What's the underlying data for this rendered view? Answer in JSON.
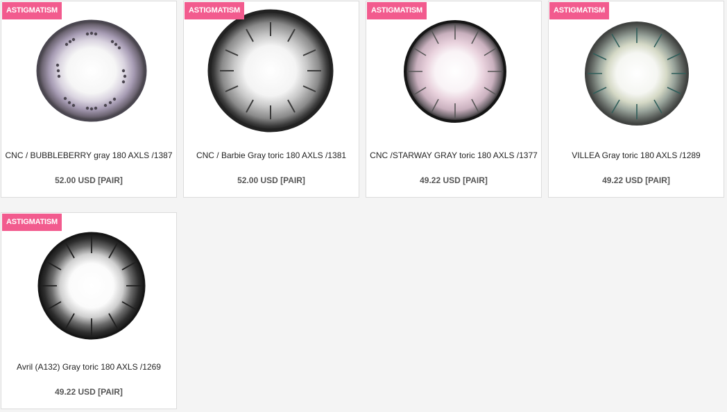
{
  "accent_color": "#f25b8e",
  "products": [
    {
      "badge": "ASTIGMATISM",
      "name": "CNC / BUBBLEBERRY gray 180 AXLS /1387",
      "price": "52.00 USD [PAIR]",
      "icon": "purple-gray-contact-lens-image"
    },
    {
      "badge": "ASTIGMATISM",
      "name": "CNC / Barbie Gray toric 180 AXLS /1381",
      "price": "52.00 USD [PAIR]",
      "icon": "gray-contact-lens-image"
    },
    {
      "badge": "ASTIGMATISM",
      "name": "CNC /STARWAY GRAY toric 180 AXLS /1377",
      "price": "49.22 USD [PAIR]",
      "icon": "pink-gray-contact-lens-image"
    },
    {
      "badge": "ASTIGMATISM",
      "name": "VILLEA Gray toric 180 AXLS /1289",
      "price": "49.22 USD [PAIR]",
      "icon": "green-gray-contact-lens-image"
    },
    {
      "badge": "ASTIGMATISM",
      "name": "Avril (A132) Gray toric 180 AXLS /1269",
      "price": "49.22 USD [PAIR]",
      "icon": "dark-gray-contact-lens-image"
    }
  ]
}
